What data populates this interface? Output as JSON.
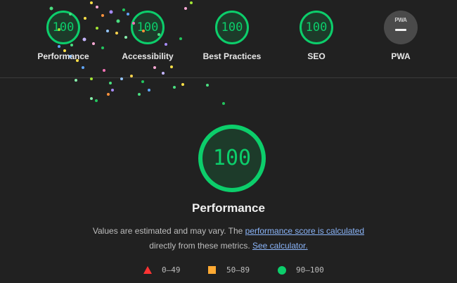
{
  "header": {
    "gauges": [
      {
        "score": "100",
        "label": "Performance"
      },
      {
        "score": "100",
        "label": "Accessibility"
      },
      {
        "score": "100",
        "label": "Best Practices"
      },
      {
        "score": "100",
        "label": "SEO"
      }
    ],
    "pwa": {
      "badge_text": "PWA",
      "label": "PWA",
      "icon": "pwa-dash-icon"
    }
  },
  "main": {
    "score": "100",
    "title": "Performance",
    "desc_part1": "Values are estimated and may vary. The ",
    "desc_link1": "performance score is calculated",
    "desc_part2": "directly from these metrics. ",
    "desc_link2": "See calculator."
  },
  "legend": {
    "fail": "0–49",
    "average": "50–89",
    "pass": "90–100"
  },
  "colors": {
    "pass": "#0cce6b",
    "average": "#ffaa33",
    "fail": "#ff3333",
    "background": "#212121",
    "link": "#8ab4f8"
  }
}
